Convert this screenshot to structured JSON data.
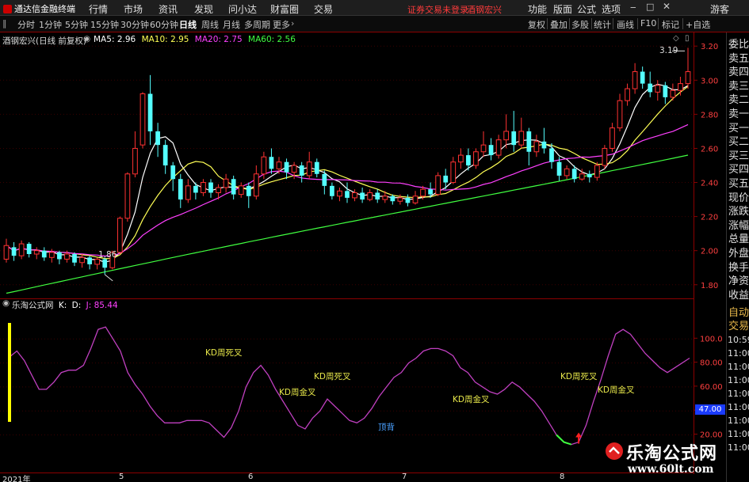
{
  "menubar": {
    "app_title": "通达信金融终端",
    "items": [
      "行情",
      "市场",
      "资讯",
      "发现",
      "问小达",
      "财富圈",
      "交易"
    ],
    "notice": "证券交易未登录",
    "stock_name": "酒钢宏兴",
    "right_items": [
      "功能",
      "版面",
      "公式",
      "选项"
    ],
    "guest": "游客"
  },
  "toolbar": {
    "periods": [
      "分时",
      "1分钟",
      "5分钟",
      "15分钟",
      "30分钟",
      "60分钟",
      "日线",
      "周线",
      "月线",
      "多周期",
      "更多"
    ],
    "active": "日线",
    "right_buttons": [
      "复权",
      "叠加",
      "多股",
      "统计",
      "画线",
      "F10",
      "标记",
      "+自选"
    ]
  },
  "main_chart": {
    "title": "酒钢宏兴(日线 前复权)",
    "ma_labels": [
      {
        "name": "MA5",
        "value": "2.96",
        "color": "#ffffff"
      },
      {
        "name": "MA10",
        "value": "2.95",
        "color": "#ffff55"
      },
      {
        "name": "MA20",
        "value": "2.75",
        "color": "#ff40ff"
      },
      {
        "name": "MA60",
        "value": "2.56",
        "color": "#40ff40"
      }
    ],
    "high_label": "3.19",
    "low_label": "1.86",
    "y_ticks": [
      "3.20",
      "3.00",
      "2.80",
      "2.60",
      "2.40",
      "2.20",
      "2.00",
      "1.80"
    ]
  },
  "sub_chart": {
    "title": "乐淘公式网",
    "k_label": "K:",
    "d_label": "D:",
    "j_label": "J: 85.44",
    "y_ticks": [
      "100.0",
      "80.00",
      "60.00",
      "40.00",
      "20.00"
    ],
    "current_value": "47.00",
    "annotations": [
      "KD周死叉",
      "KD周金叉",
      "KD周死叉",
      "顶背",
      "KD周金叉",
      "KD周死叉",
      "KD周金叉"
    ]
  },
  "date_axis": {
    "labels": [
      "2021年",
      "5",
      "6",
      "7",
      "8"
    ]
  },
  "side_panel": {
    "items": [
      "委比",
      "卖五",
      "卖四",
      "卖三",
      "卖二",
      "卖一",
      "买一",
      "买二",
      "买三",
      "买四",
      "买五",
      "现价",
      "涨跌",
      "涨幅",
      "总量",
      "外盘",
      "换手",
      "净资",
      "收益"
    ],
    "lower_items": [
      "自动",
      "交易"
    ],
    "times": [
      "10:59",
      "11:00",
      "11:00",
      "11:00",
      "11:00",
      "11:00",
      "11:00",
      "11:00",
      "11:00"
    ]
  },
  "watermark": {
    "title": "乐淘公式网",
    "url": "www.60lt.com"
  },
  "chart_data": {
    "type": "candlestick",
    "title": "酒钢宏兴(日线 前复权)",
    "ylim": [
      1.72,
      3.28
    ],
    "candles": [
      [
        1.95,
        2.03,
        1.93,
        2.07
      ],
      [
        2.02,
        1.97,
        1.94,
        2.05
      ],
      [
        1.97,
        2.04,
        1.95,
        2.06
      ],
      [
        2.04,
        1.98,
        1.96,
        2.05
      ],
      [
        1.98,
        2.0,
        1.95,
        2.02
      ],
      [
        2.0,
        1.96,
        1.94,
        2.02
      ],
      [
        1.96,
        1.99,
        1.93,
        2.01
      ],
      [
        1.99,
        1.95,
        1.92,
        2.0
      ],
      [
        1.95,
        1.98,
        1.93,
        2.0
      ],
      [
        1.98,
        1.93,
        1.91,
        1.99
      ],
      [
        1.93,
        1.96,
        1.9,
        1.98
      ],
      [
        1.96,
        1.92,
        1.89,
        1.97
      ],
      [
        1.92,
        1.95,
        1.89,
        1.96
      ],
      [
        1.95,
        1.9,
        1.86,
        1.96
      ],
      [
        1.9,
        1.99,
        1.89,
        2.0
      ],
      [
        1.99,
        2.19,
        1.98,
        2.2
      ],
      [
        2.19,
        2.45,
        2.17,
        2.46
      ],
      [
        2.45,
        2.6,
        2.43,
        2.7
      ],
      [
        2.62,
        2.92,
        2.6,
        2.93
      ],
      [
        2.92,
        2.7,
        2.62,
        3.03
      ],
      [
        2.7,
        2.62,
        2.55,
        2.75
      ],
      [
        2.62,
        2.5,
        2.45,
        2.65
      ],
      [
        2.5,
        2.42,
        2.35,
        2.52
      ],
      [
        2.42,
        2.3,
        2.25,
        2.45
      ],
      [
        2.3,
        2.38,
        2.28,
        2.42
      ],
      [
        2.38,
        2.34,
        2.3,
        2.4
      ],
      [
        2.34,
        2.4,
        2.32,
        2.42
      ],
      [
        2.4,
        2.34,
        2.31,
        2.42
      ],
      [
        2.34,
        2.37,
        2.3,
        2.39
      ],
      [
        2.37,
        2.42,
        2.34,
        2.45
      ],
      [
        2.42,
        2.33,
        2.3,
        2.44
      ],
      [
        2.33,
        2.38,
        2.31,
        2.4
      ],
      [
        2.38,
        2.32,
        2.25,
        2.4
      ],
      [
        2.32,
        2.45,
        2.3,
        2.5
      ],
      [
        2.45,
        2.55,
        2.42,
        2.58
      ],
      [
        2.55,
        2.48,
        2.45,
        2.6
      ],
      [
        2.48,
        2.52,
        2.45,
        2.55
      ],
      [
        2.52,
        2.46,
        2.42,
        2.54
      ],
      [
        2.46,
        2.5,
        2.42,
        2.52
      ],
      [
        2.5,
        2.44,
        2.4,
        2.52
      ],
      [
        2.44,
        2.52,
        2.42,
        2.58
      ],
      [
        2.52,
        2.45,
        2.43,
        2.54
      ],
      [
        2.45,
        2.38,
        2.33,
        2.47
      ],
      [
        2.38,
        2.32,
        2.3,
        2.4
      ],
      [
        2.32,
        2.35,
        2.29,
        2.37
      ],
      [
        2.35,
        2.31,
        2.28,
        2.4
      ],
      [
        2.31,
        2.34,
        2.29,
        2.36
      ],
      [
        2.34,
        2.3,
        2.28,
        2.37
      ],
      [
        2.3,
        2.34,
        2.29,
        2.36
      ],
      [
        2.34,
        2.3,
        2.28,
        2.36
      ],
      [
        2.3,
        2.32,
        2.28,
        2.35
      ],
      [
        2.32,
        2.29,
        2.27,
        2.33
      ],
      [
        2.29,
        2.31,
        2.27,
        2.33
      ],
      [
        2.31,
        2.28,
        2.26,
        2.33
      ],
      [
        2.28,
        2.32,
        2.27,
        2.35
      ],
      [
        2.32,
        2.36,
        2.3,
        2.38
      ],
      [
        2.36,
        2.33,
        2.31,
        2.4
      ],
      [
        2.33,
        2.44,
        2.32,
        2.46
      ],
      [
        2.44,
        2.4,
        2.36,
        2.48
      ],
      [
        2.4,
        2.52,
        2.39,
        2.55
      ],
      [
        2.52,
        2.56,
        2.48,
        2.6
      ],
      [
        2.56,
        2.5,
        2.47,
        2.6
      ],
      [
        2.5,
        2.58,
        2.48,
        2.6
      ],
      [
        2.58,
        2.62,
        2.55,
        2.7
      ],
      [
        2.62,
        2.56,
        2.53,
        2.66
      ],
      [
        2.56,
        2.65,
        2.54,
        2.68
      ],
      [
        2.65,
        2.7,
        2.6,
        2.8
      ],
      [
        2.7,
        2.62,
        2.58,
        2.82
      ],
      [
        2.62,
        2.7,
        2.6,
        2.78
      ],
      [
        2.7,
        2.58,
        2.5,
        2.72
      ],
      [
        2.58,
        2.64,
        2.55,
        2.68
      ],
      [
        2.64,
        2.6,
        2.57,
        2.72
      ],
      [
        2.6,
        2.52,
        2.48,
        2.63
      ],
      [
        2.52,
        2.44,
        2.41,
        2.55
      ],
      [
        2.44,
        2.48,
        2.42,
        2.5
      ],
      [
        2.48,
        2.42,
        2.4,
        2.5
      ],
      [
        2.42,
        2.45,
        2.41,
        2.48
      ],
      [
        2.45,
        2.43,
        2.4,
        2.47
      ],
      [
        2.43,
        2.5,
        2.41,
        2.52
      ],
      [
        2.5,
        2.6,
        2.48,
        2.62
      ],
      [
        2.6,
        2.72,
        2.58,
        2.75
      ],
      [
        2.72,
        2.88,
        2.7,
        2.92
      ],
      [
        2.88,
        2.95,
        2.85,
        2.98
      ],
      [
        2.95,
        3.05,
        2.92,
        3.1
      ],
      [
        3.05,
        2.98,
        2.95,
        3.08
      ],
      [
        2.98,
        2.93,
        2.9,
        3.05
      ],
      [
        2.93,
        2.97,
        2.88,
        3.0
      ],
      [
        2.97,
        2.9,
        2.86,
        2.99
      ],
      [
        2.9,
        2.94,
        2.88,
        2.98
      ],
      [
        2.94,
        2.98,
        2.91,
        3.02
      ],
      [
        2.98,
        3.05,
        2.95,
        3.19
      ]
    ],
    "k_series": [
      85,
      84,
      82,
      78,
      70,
      60,
      55,
      58,
      68,
      80,
      92,
      98,
      100,
      102,
      100,
      96,
      88,
      80,
      72,
      64,
      58,
      52,
      48,
      44,
      40,
      40,
      42,
      44,
      45,
      48,
      52,
      55,
      50,
      47,
      54,
      62,
      72,
      78,
      80,
      76,
      66,
      58,
      48,
      40,
      34,
      30,
      28,
      28,
      30,
      34,
      38,
      44,
      42,
      36,
      32,
      30,
      34,
      42,
      52,
      60,
      66,
      72,
      76,
      80,
      84,
      86,
      88,
      86,
      82,
      78,
      72,
      66,
      58,
      52,
      46,
      44,
      48,
      56,
      64,
      74,
      84,
      94,
      100,
      104,
      98,
      90,
      84,
      80,
      78,
      78,
      82,
      85
    ],
    "j_series": [
      85,
      90,
      82,
      70,
      58,
      58,
      64,
      72,
      74,
      74,
      78,
      92,
      108,
      110,
      100,
      90,
      72,
      62,
      54,
      44,
      36,
      30,
      30,
      30,
      32,
      32,
      32,
      30,
      24,
      18,
      26,
      40,
      60,
      72,
      78,
      70,
      58,
      48,
      38,
      28,
      25,
      34,
      40,
      50,
      44,
      38,
      32,
      30,
      34,
      42,
      52,
      60,
      68,
      72,
      80,
      84,
      90,
      92,
      92,
      90,
      86,
      76,
      72,
      64,
      60,
      56,
      54,
      58,
      64,
      60,
      54,
      48,
      40,
      30,
      20,
      14,
      12,
      14,
      28,
      48,
      66,
      86,
      104,
      108,
      104,
      96,
      88,
      82,
      76,
      72,
      76,
      80,
      84
    ]
  }
}
